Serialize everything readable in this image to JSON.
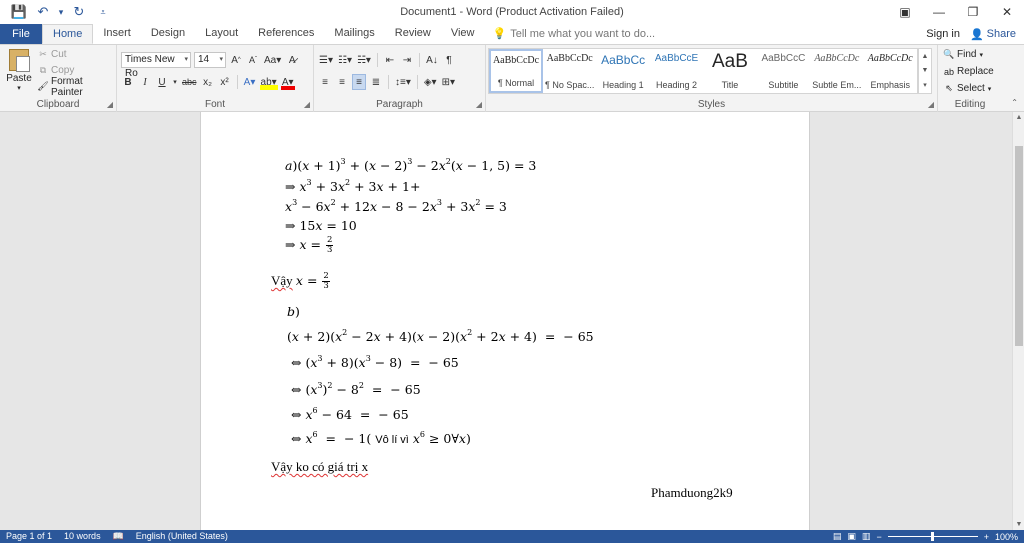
{
  "window": {
    "title": "Document1 - Word (Product Activation Failed)",
    "controls": {
      "ribbon_display": "▣",
      "minimize": "—",
      "restore": "❐",
      "close": "✕"
    }
  },
  "qat": {
    "save": "💾",
    "undo": "↶",
    "undo_drop": "▾",
    "redo": "↻",
    "customize": "⩡"
  },
  "tabs": {
    "file": "File",
    "items": [
      "Home",
      "Insert",
      "Design",
      "Layout",
      "References",
      "Mailings",
      "Review",
      "View"
    ],
    "tell_me": "Tell me what you want to do...",
    "sign_in": "Sign in",
    "share": "Share"
  },
  "ribbon": {
    "clipboard": {
      "label": "Clipboard",
      "paste": "Paste",
      "cut": "Cut",
      "copy": "Copy",
      "format_painter": "Format Painter"
    },
    "font": {
      "label": "Font",
      "font_name": "Times New Ro",
      "font_size": "14"
    },
    "paragraph": {
      "label": "Paragraph"
    },
    "styles": {
      "label": "Styles",
      "items": [
        {
          "preview": "AaBbCcDc",
          "name": "¶ Normal"
        },
        {
          "preview": "AaBbCcDc",
          "name": "¶ No Spac..."
        },
        {
          "preview": "AaBbCc",
          "name": "Heading 1"
        },
        {
          "preview": "AaBbCcE",
          "name": "Heading 2"
        },
        {
          "preview": "AaB",
          "name": "Title"
        },
        {
          "preview": "AaBbCcC",
          "name": "Subtitle"
        },
        {
          "preview": "AaBbCcDc",
          "name": "Subtle Em..."
        },
        {
          "preview": "AaBbCcDc",
          "name": "Emphasis"
        }
      ]
    },
    "editing": {
      "label": "Editing",
      "find": "Find",
      "replace": "Replace",
      "select": "Select"
    }
  },
  "document": {
    "conclusion_a_word": "Vậy",
    "conclusion_b": "Vậy ko có giá trị x",
    "note_word": "Vô lí vì",
    "signature": "Phamduong2k9"
  },
  "status": {
    "page": "Page 1 of 1",
    "words": "10 words",
    "language": "English (United States)",
    "zoom": "100%"
  }
}
